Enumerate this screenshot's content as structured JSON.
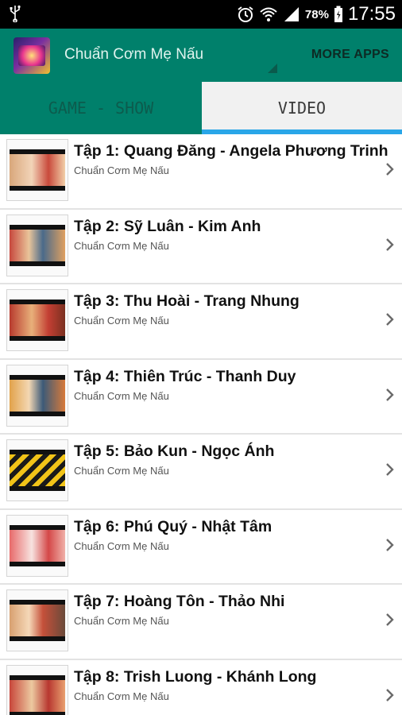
{
  "status_bar": {
    "battery_percent": "78%",
    "time": "17:55",
    "icons": [
      "usb-icon",
      "alarm-icon",
      "wifi-icon",
      "signal-icon",
      "battery-icon"
    ]
  },
  "app_bar": {
    "title": "Chuẩn Cơm Mẹ Nấu",
    "more_apps_label": "MORE APPS"
  },
  "tabs": [
    {
      "label": "GAME - SHOW",
      "selected": false
    },
    {
      "label": "VIDEO",
      "selected": true
    }
  ],
  "colors": {
    "app_bar": "#00806b",
    "tab_indicator": "#29a6e8"
  },
  "list": {
    "items": [
      {
        "title": "Tập 1: Quang Đăng -  Angela Phương Trinh",
        "subtitle": "Chuẩn Cơm Mẹ Nấu"
      },
      {
        "title": "Tập 2: Sỹ Luân - Kim Anh",
        "subtitle": "Chuẩn Cơm Mẹ Nấu"
      },
      {
        "title": "Tập 3: Thu Hoài - Trang Nhung",
        "subtitle": "Chuẩn Cơm Mẹ Nấu"
      },
      {
        "title": "Tập 4: Thiên Trúc - Thanh Duy",
        "subtitle": "Chuẩn Cơm Mẹ Nấu"
      },
      {
        "title": "Tập 5: Bảo Kun - Ngọc Ánh",
        "subtitle": "Chuẩn Cơm Mẹ Nấu"
      },
      {
        "title": "Tập 6: Phú Quý - Nhật Tâm",
        "subtitle": "Chuẩn Cơm Mẹ Nấu"
      },
      {
        "title": "Tập 7: Hoàng Tôn - Thảo Nhi",
        "subtitle": "Chuẩn Cơm Mẹ Nấu"
      },
      {
        "title": "Tập 8: Trish Luong -  Khánh Long",
        "subtitle": "Chuẩn Cơm Mẹ Nấu"
      }
    ]
  }
}
